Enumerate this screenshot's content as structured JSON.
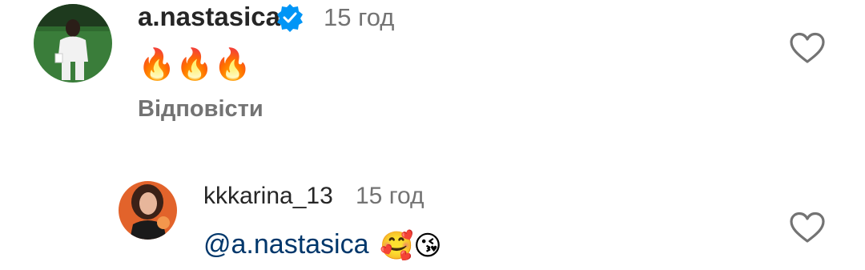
{
  "comments": [
    {
      "username": "a.nastasica",
      "verified": true,
      "time": "15 год",
      "text_emoji": "🔥🔥🔥",
      "reply_label": "Відповісти",
      "like_icon": "heart-outline-icon",
      "avatar_icon": "user-avatar"
    },
    {
      "username": "kkkarina_13",
      "verified": false,
      "time": "15 год",
      "mention": "@a.nastasica",
      "text_emoji": "🥰😘",
      "like_icon": "heart-outline-icon",
      "avatar_icon": "user-avatar"
    }
  ],
  "colors": {
    "username": "#262626",
    "meta": "#737373",
    "mention": "#00376b",
    "verified_badge": "#0095f6"
  }
}
